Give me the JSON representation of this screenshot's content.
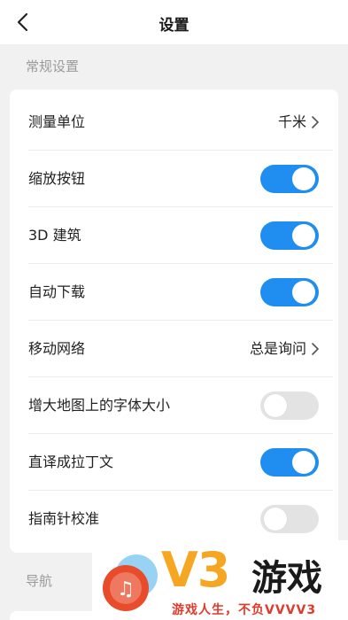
{
  "header": {
    "title": "设置",
    "back_icon": "chevron-left-icon"
  },
  "general": {
    "section_title": "常规设置",
    "items": [
      {
        "label": "测量单位",
        "type": "link",
        "value": "千米"
      },
      {
        "label": "缩放按钮",
        "type": "toggle",
        "on": true
      },
      {
        "label": "3D 建筑",
        "type": "toggle",
        "on": true
      },
      {
        "label": "自动下载",
        "type": "toggle",
        "on": true
      },
      {
        "label": "移动网络",
        "type": "link",
        "value": "总是询问"
      },
      {
        "label": "增大地图上的字体大小",
        "type": "toggle",
        "on": false
      },
      {
        "label": "直译成拉丁文",
        "type": "toggle",
        "on": true
      },
      {
        "label": "指南针校准",
        "type": "toggle",
        "on": false
      }
    ]
  },
  "navigation": {
    "section_title": "导航"
  },
  "watermark": {
    "brand": "V3",
    "name": "游戏",
    "slogan": "游戏人生，不负VVVV3"
  },
  "colors": {
    "accent": "#1f8ef0",
    "toggle_off": "#e3e3e3",
    "background": "#f1f1f1",
    "watermark_orange": "#f5a623",
    "watermark_red": "#e03a2a"
  }
}
